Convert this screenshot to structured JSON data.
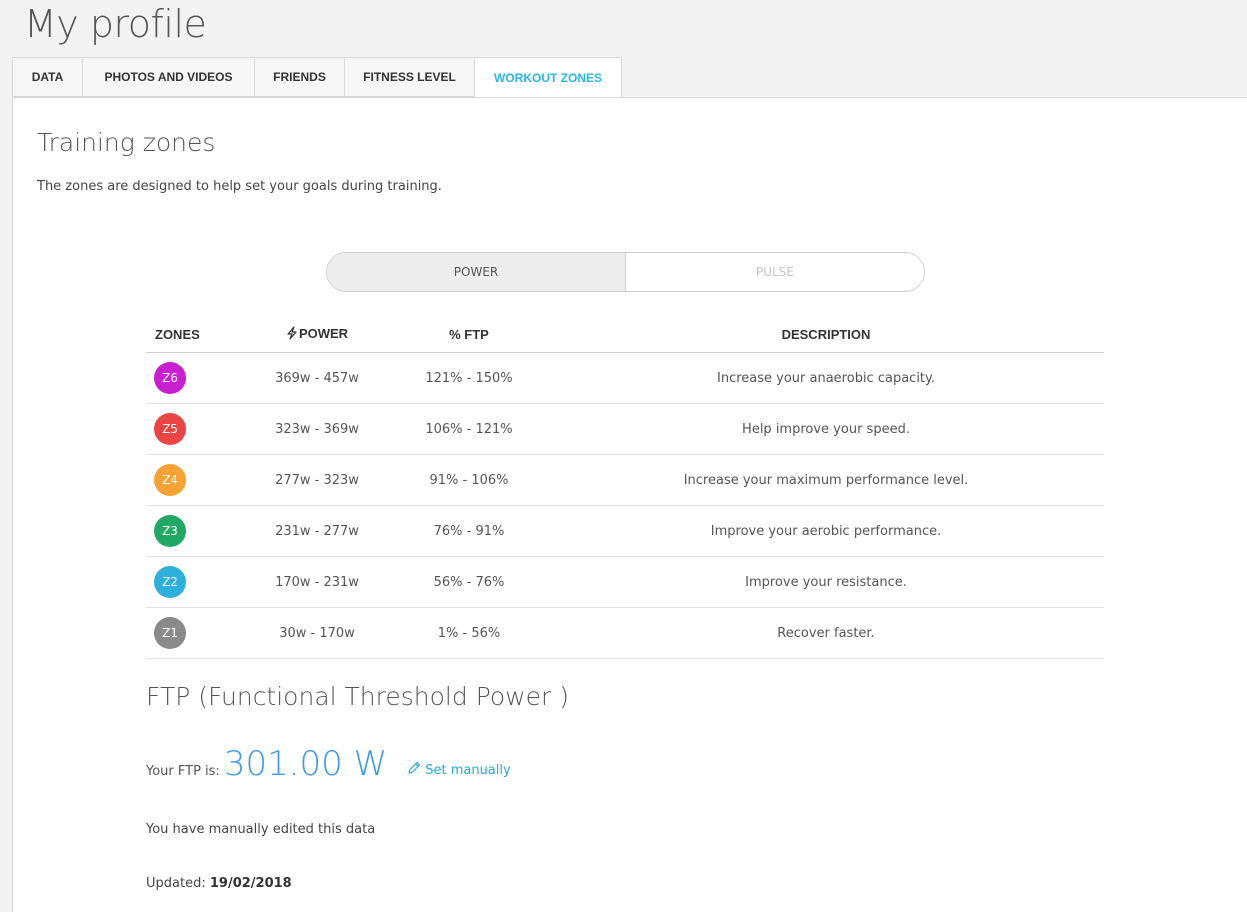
{
  "page": {
    "title": "My profile"
  },
  "tabs": [
    {
      "label": "DATA"
    },
    {
      "label": "PHOTOS AND VIDEOS"
    },
    {
      "label": "FRIENDS"
    },
    {
      "label": "FITNESS LEVEL"
    },
    {
      "label": "WORKOUT ZONES",
      "active": true
    }
  ],
  "section": {
    "title": "Training zones",
    "intro": "The zones are designed to help set your goals during training."
  },
  "toggle": {
    "power": "POWER",
    "pulse": "PULSE",
    "selected": "POWER"
  },
  "table": {
    "headers": {
      "zones": "ZONES",
      "power": "POWER",
      "ftp": "% FTP",
      "description": "DESCRIPTION"
    },
    "rows": [
      {
        "zone": "Z6",
        "color": "#c81fd1",
        "power": "369w - 457w",
        "ftp": "121% - 150%",
        "description": "Increase your anaerobic capacity."
      },
      {
        "zone": "Z5",
        "color": "#ea4444",
        "power": "323w - 369w",
        "ftp": "106% - 121%",
        "description": "Help improve your speed."
      },
      {
        "zone": "Z4",
        "color": "#f7a234",
        "power": "277w - 323w",
        "ftp": "91% - 106%",
        "description": "Increase your maximum performance level."
      },
      {
        "zone": "Z3",
        "color": "#22a865",
        "power": "231w - 277w",
        "ftp": "76% - 91%",
        "description": "Improve your aerobic performance."
      },
      {
        "zone": "Z2",
        "color": "#2eb0df",
        "power": "170w - 231w",
        "ftp": "56% - 76%",
        "description": "Improve your resistance."
      },
      {
        "zone": "Z1",
        "color": "#8a8a8a",
        "power": "30w - 170w",
        "ftp": "1% - 56%",
        "description": "Recover faster."
      }
    ]
  },
  "ftp": {
    "title": "FTP (Functional Threshold Power )",
    "label": "Your FTP is:",
    "value": "301.00 W",
    "set_manually": "Set manually",
    "edited_note": "You have manually edited this data",
    "updated_label": "Updated:",
    "updated_date": "19/02/2018"
  },
  "colors": {
    "accent": "#29b6e0",
    "ftp_value": "#3b9ae9"
  }
}
